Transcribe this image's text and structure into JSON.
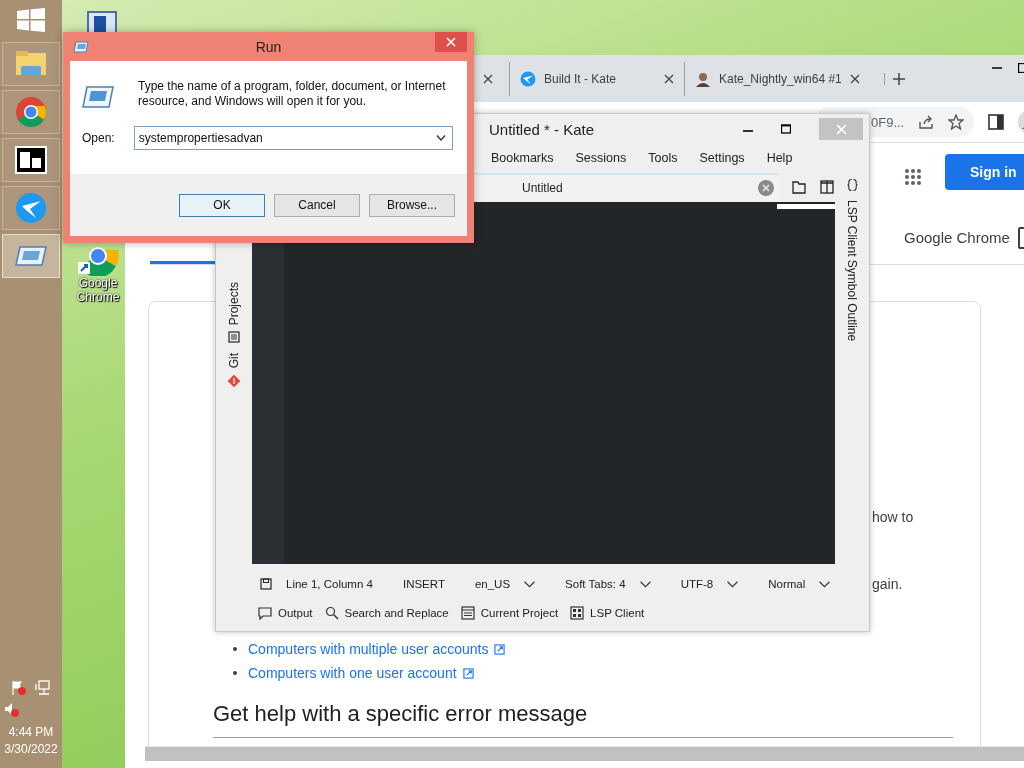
{
  "taskbar": {
    "apps": [
      {
        "selected": false
      },
      {
        "selected": false
      },
      {
        "selected": false
      },
      {
        "selected": false
      },
      {
        "selected": true
      }
    ],
    "time": "4:44 PM",
    "date": "3/30/2022"
  },
  "desktop_icons": [
    {
      "label": "Google Chrome"
    }
  ],
  "chrome": {
    "tabs": [
      {
        "title": "Build It - Kate"
      },
      {
        "title": "Kate_Nightly_win64 #1"
      }
    ],
    "address": "0F9...",
    "page": {
      "sign_in": "Sign in",
      "product": "Google Chrome",
      "fragments": [
        "how to",
        "gain."
      ],
      "links": [
        "Computers with multiple user accounts",
        "Computers with one user account"
      ],
      "heading": "Get help with a specific error message"
    }
  },
  "kate": {
    "title": "Untitled * - Kate",
    "menu": [
      "Bookmarks",
      "Sessions",
      "Tools",
      "Settings",
      "Help"
    ],
    "doc_tab": "Untitled",
    "left_panels": [
      "Projects",
      "Git"
    ],
    "right_panels": [
      "LSP Client Symbol Outline"
    ],
    "status": [
      {
        "text": "Line 1, Column 4",
        "dropdown": false
      },
      {
        "text": "INSERT",
        "dropdown": false
      },
      {
        "text": "en_US",
        "dropdown": true
      },
      {
        "text": "Soft Tabs: 4",
        "dropdown": true
      },
      {
        "text": "UTF-8",
        "dropdown": true
      },
      {
        "text": "Normal",
        "dropdown": true
      }
    ],
    "tool_views": [
      "Output",
      "Search and Replace",
      "Current Project",
      "LSP Client"
    ]
  },
  "run": {
    "title": "Run",
    "prompt": "Type the name of a program, folder, document, or Internet resource, and Windows will open it for you.",
    "open_label": "Open:",
    "value": "systempropertiesadvan",
    "buttons": [
      {
        "label": "OK",
        "default": true
      },
      {
        "label": "Cancel",
        "default": false
      },
      {
        "label": "Browse...",
        "default": false
      }
    ]
  }
}
